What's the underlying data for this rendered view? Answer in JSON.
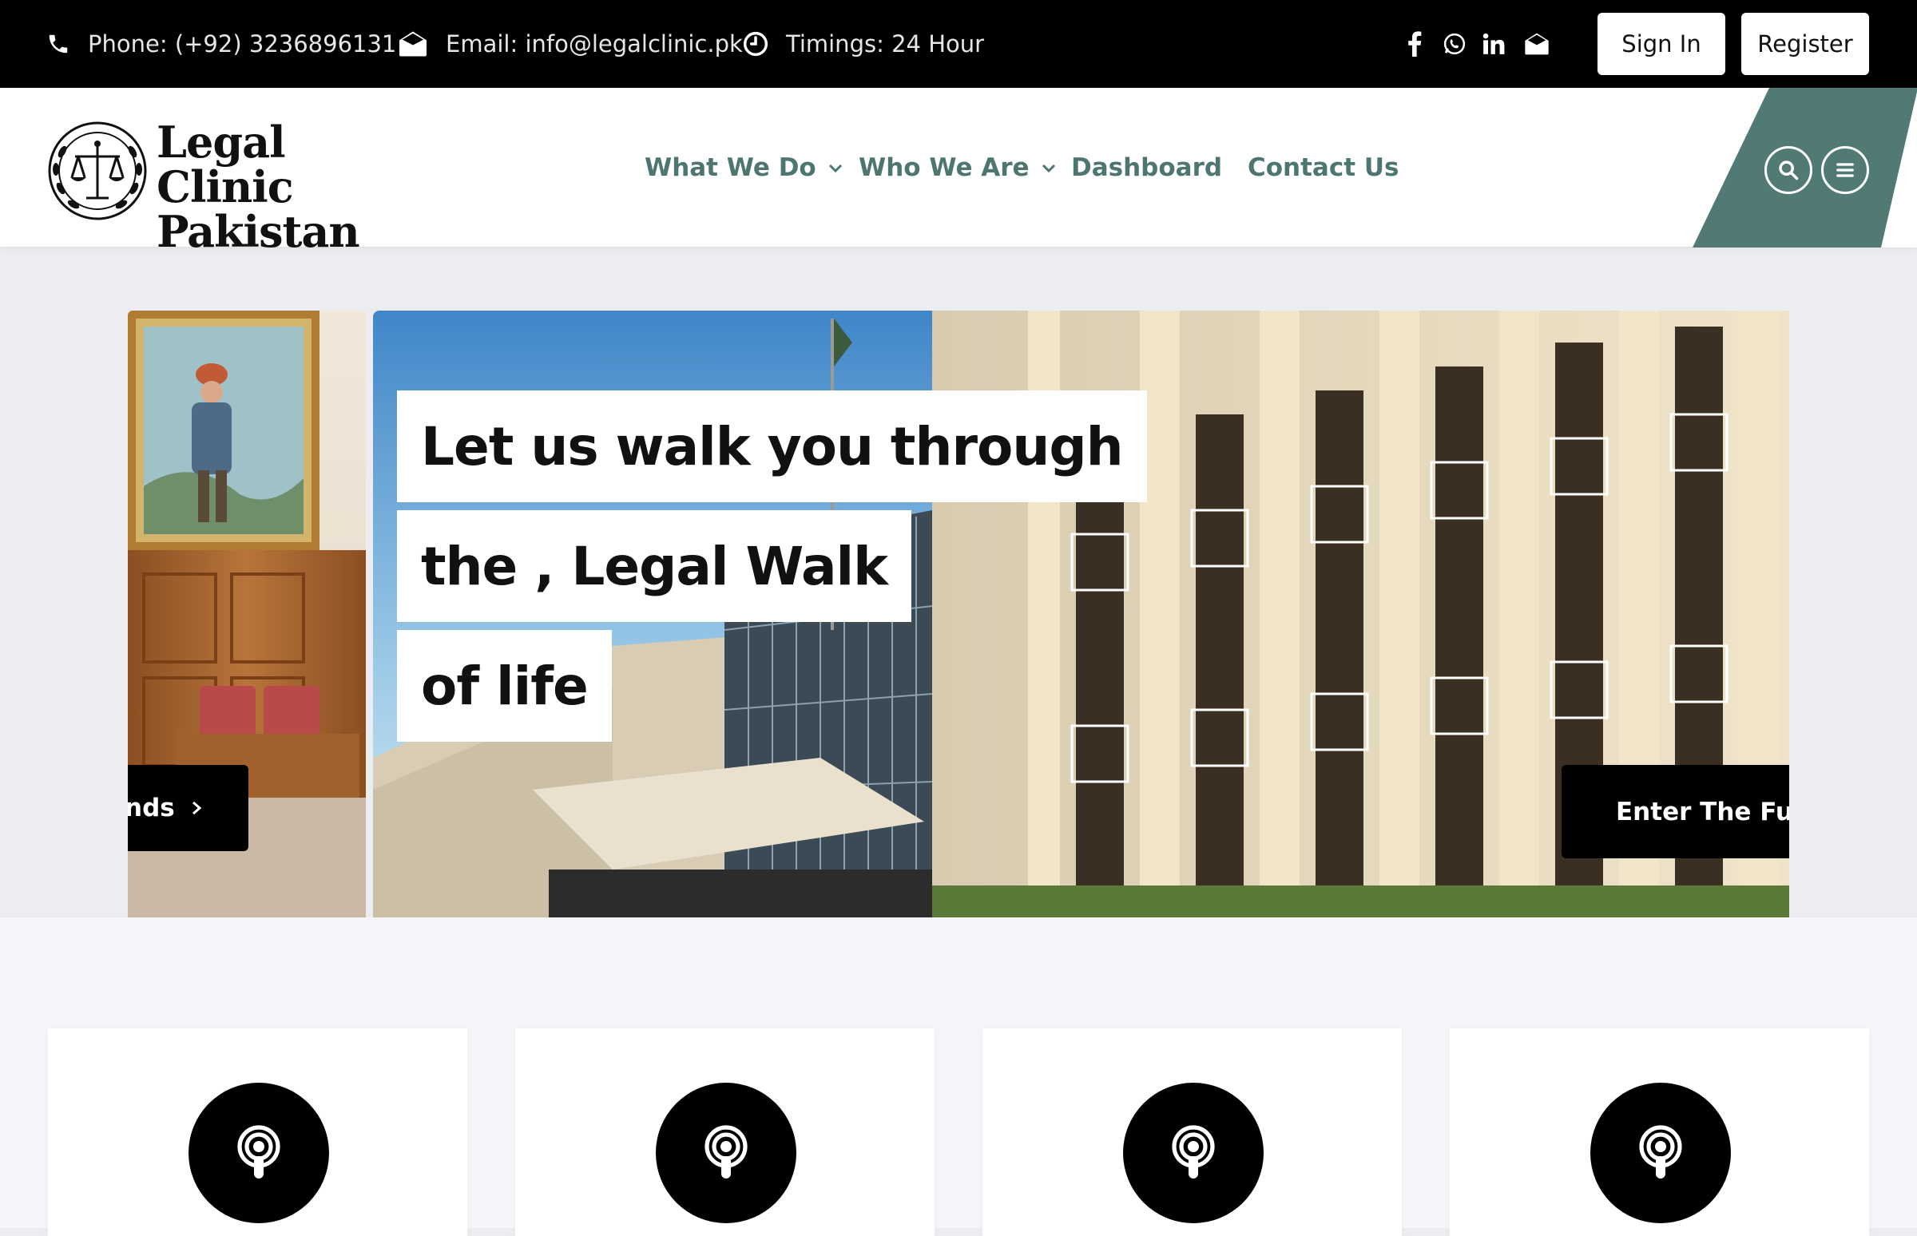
{
  "topbar": {
    "phone": "Phone: (+92) 3236896131",
    "email": "Email: info@legalclinic.pk",
    "timings": "Timings: 24 Hour",
    "social_icons": [
      "facebook-icon",
      "whatsapp-icon",
      "linkedin-icon",
      "envelope-icon"
    ],
    "signin_label": "Sign In",
    "register_label": "Register"
  },
  "header": {
    "logo_line1": "Legal Clinic",
    "logo_line2": "Pakistan",
    "nav": [
      {
        "label": "What We Do",
        "dropdown": true
      },
      {
        "label": "Who We Are",
        "dropdown": true
      },
      {
        "label": "Dashboard",
        "dropdown": false
      },
      {
        "label": "Contact Us",
        "dropdown": false
      }
    ],
    "accent_color": "#527a75"
  },
  "hero": {
    "headline_lines": [
      "Let us walk you through",
      "the , Legal Walk",
      "of life"
    ],
    "left_cta_label": "nds",
    "right_cta_label": "Enter The Futur"
  },
  "cards": [
    {
      "icon": "podcast-icon"
    },
    {
      "icon": "podcast-icon"
    },
    {
      "icon": "podcast-icon"
    },
    {
      "icon": "podcast-icon"
    }
  ]
}
